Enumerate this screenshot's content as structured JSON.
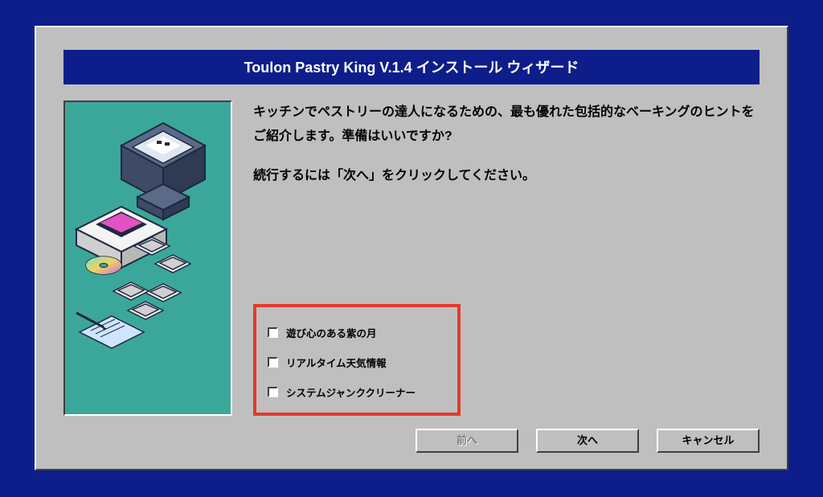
{
  "title": "Toulon Pastry King V.1.4 インストール ウィザード",
  "intro": {
    "line1": "キッチンでペストリーの達人になるための、最も優れた包括的なベーキングのヒントをご紹介します。準備はいいですか?",
    "line2": "続行するには「次へ」をクリックしてください。"
  },
  "options": [
    {
      "label": "遊び心のある紫の月",
      "checked": false
    },
    {
      "label": "リアルタイム天気情報",
      "checked": false
    },
    {
      "label": "システムジャンククリーナー",
      "checked": false
    }
  ],
  "buttons": {
    "back": "前へ",
    "next": "次へ",
    "cancel": "キャンセル"
  },
  "colors": {
    "desktop": "#0d1e8b",
    "panel": "#bfbfbf",
    "teal": "#3ba79a",
    "highlight": "#e23a2e"
  }
}
